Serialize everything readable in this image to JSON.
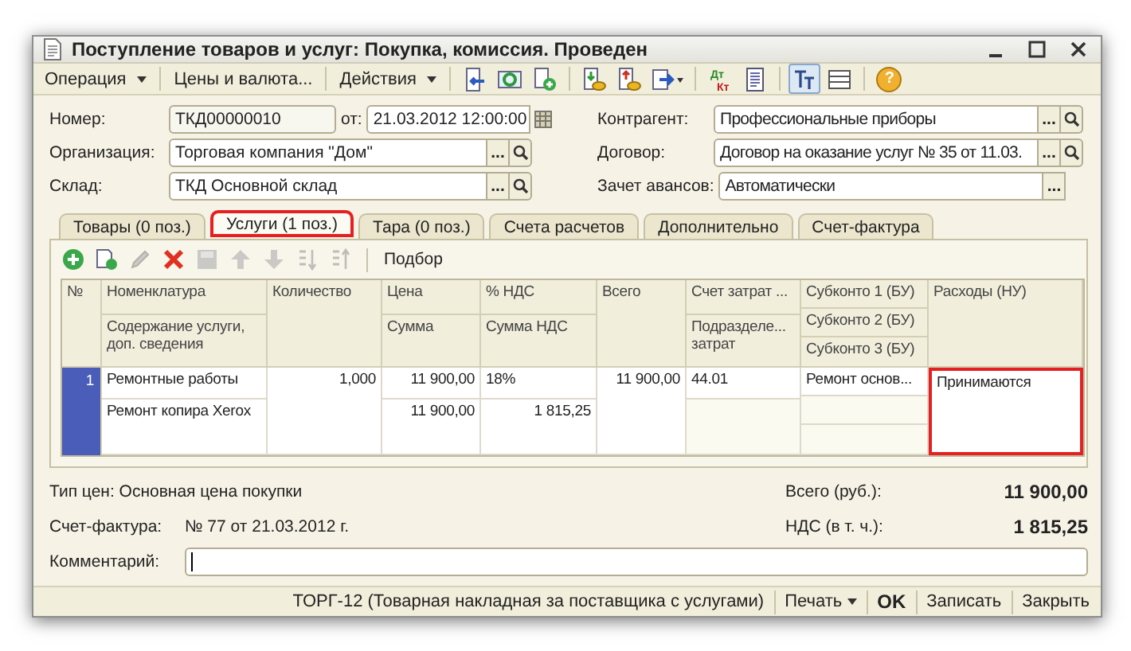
{
  "window": {
    "title": "Поступление товаров и услуг: Покупка, комиссия. Проведен"
  },
  "toolbar": {
    "menus": [
      {
        "label": "Операция",
        "dropdown": true
      },
      {
        "label": "Цены и валюта...",
        "dropdown": false
      },
      {
        "label": "Действия",
        "dropdown": true
      }
    ],
    "icons": [
      {
        "kind": "doc-arrow",
        "pressed": false
      },
      {
        "kind": "refresh",
        "pressed": false
      },
      {
        "kind": "doc-add",
        "pressed": false
      },
      {
        "kind": "coins-down",
        "pressed": false
      },
      {
        "kind": "coins-up",
        "pressed": false
      },
      {
        "kind": "doc-menu",
        "pressed": false
      },
      {
        "kind": "dtkt",
        "pressed": false,
        "lines": [
          "Дт",
          "Кт"
        ]
      },
      {
        "kind": "report",
        "pressed": false
      },
      {
        "kind": "tt",
        "pressed": true
      },
      {
        "kind": "list",
        "pressed": false
      },
      {
        "kind": "help",
        "pressed": false,
        "label": "?"
      }
    ]
  },
  "fields": {
    "left": [
      {
        "kind": "number",
        "label": "Номер:",
        "value": "ТКД00000010",
        "date_label": "от:",
        "date": "21.03.2012 12:00:00"
      },
      {
        "kind": "ref",
        "label": "Организация:",
        "value": "Торговая компания \"Дом\"",
        "choose": "...",
        "search": true
      },
      {
        "kind": "ref",
        "label": "Склад:",
        "value": "ТКД Основной склад",
        "choose": "...",
        "search": true
      }
    ],
    "right": [
      {
        "kind": "ref",
        "label": "Контрагент:",
        "value": "Профессиональные приборы",
        "choose": "...",
        "search": true
      },
      {
        "kind": "ref",
        "label": "Договор:",
        "value": "Договор на оказание услуг № 35 от 11.03.",
        "choose": "...",
        "search": true
      },
      {
        "kind": "ref",
        "label": "Зачет авансов:",
        "value": "Автоматически",
        "choose": "...",
        "search": false
      }
    ]
  },
  "tabs": [
    {
      "label": "Товары (0 поз.)",
      "selected": false
    },
    {
      "label": "Услуги (1 поз.)",
      "selected": true
    },
    {
      "label": "Тара (0 поз.)",
      "selected": false
    },
    {
      "label": "Счета расчетов",
      "selected": false
    },
    {
      "label": "Дополнительно",
      "selected": false
    },
    {
      "label": "Счет-фактура",
      "selected": false
    }
  ],
  "table_toolbar": {
    "icons": [
      {
        "kind": "add",
        "disabled": false
      },
      {
        "kind": "copy",
        "disabled": false
      },
      {
        "kind": "edit",
        "disabled": true
      },
      {
        "kind": "delete",
        "disabled": false
      },
      {
        "kind": "save",
        "disabled": true
      },
      {
        "kind": "up",
        "disabled": true
      },
      {
        "kind": "down",
        "disabled": true
      },
      {
        "kind": "sort-asc",
        "disabled": true
      },
      {
        "kind": "sort-desc",
        "disabled": true
      }
    ],
    "pick_button": "Подбор"
  },
  "table": {
    "columns": [
      {
        "headers": [
          "№"
        ]
      },
      {
        "headers": [
          "Номенклатура",
          "Содержание услуги, доп. сведения"
        ]
      },
      {
        "headers": [
          "Количество"
        ]
      },
      {
        "headers": [
          "Цена",
          "Сумма"
        ]
      },
      {
        "headers": [
          "% НДС",
          "Сумма НДС"
        ]
      },
      {
        "headers": [
          "Всего"
        ]
      },
      {
        "headers": [
          "Счет затрат ...",
          "Подразделе... затрат"
        ]
      },
      {
        "headers": [
          "Субконто 1 (БУ)",
          "Субконто 2 (БУ)",
          "Субконто 3 (БУ)"
        ]
      },
      {
        "headers": [
          "Расходы (НУ)"
        ]
      }
    ],
    "rows": [
      {
        "selected": true,
        "cells": [
          {
            "lines": [
              "1"
            ],
            "highlighted": false
          },
          {
            "lines": [
              "Ремонтные работы",
              "Ремонт копира Xerox"
            ],
            "highlighted": false
          },
          {
            "lines": [
              "1,000"
            ],
            "highlighted": false
          },
          {
            "lines": [
              "11 900,00",
              "11 900,00"
            ],
            "highlighted": false
          },
          {
            "lines": [
              "18%",
              "1 815,25"
            ],
            "highlighted": false
          },
          {
            "lines": [
              "11 900,00"
            ],
            "highlighted": false
          },
          {
            "lines": [
              "44.01"
            ],
            "highlighted": false
          },
          {
            "lines": [
              "Ремонт основ..."
            ],
            "highlighted": false
          },
          {
            "lines": [
              "Принимаются"
            ],
            "highlighted": true
          }
        ]
      }
    ]
  },
  "summary": {
    "price_type": "Тип цен: Основная цена покупки",
    "invoice": {
      "label": "Счет-фактура:",
      "value": "№ 77 от 21.03.2012 г."
    },
    "totals": [
      {
        "label": "Всего (руб.):",
        "value": "11 900,00"
      },
      {
        "label": "НДС (в т. ч.):",
        "value": "1 815,25"
      }
    ],
    "comment": {
      "label": "Комментарий:"
    }
  },
  "footer": {
    "link": "ТОРГ-12 (Товарная накладная за поставщика с услугами)",
    "buttons": [
      {
        "label": "Печать",
        "dropdown": true,
        "default": false
      },
      {
        "label": "OK",
        "dropdown": false,
        "default": true
      },
      {
        "label": "Записать",
        "dropdown": false,
        "default": false
      },
      {
        "label": "Закрыть",
        "dropdown": false,
        "default": false
      }
    ]
  }
}
